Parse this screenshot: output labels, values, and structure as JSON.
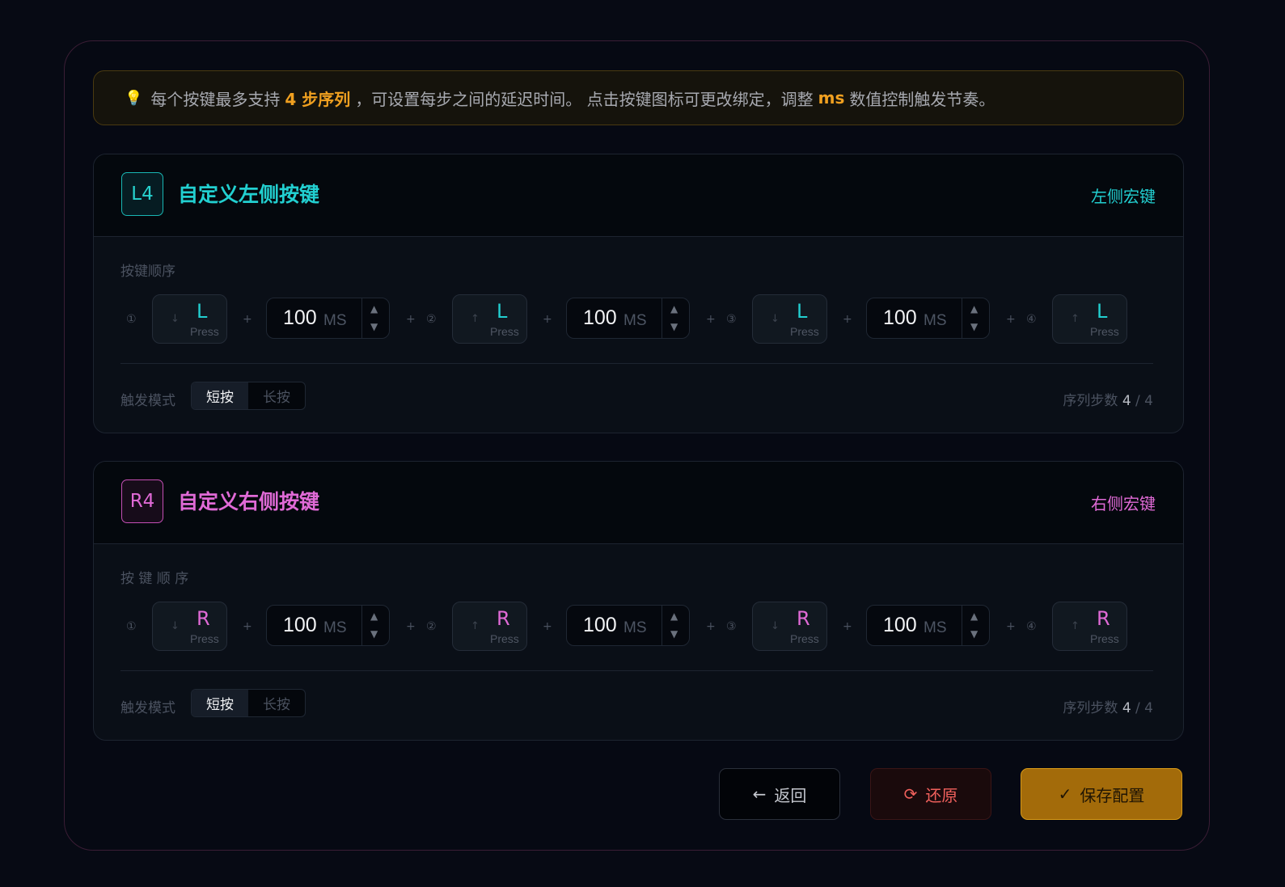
{
  "tip": {
    "icon": "lightbulb-icon",
    "text_1": "每个按键最多支持",
    "highlight_1": "4 步序列",
    "text_2": "，可设置每步之间的延迟时间。 点击按键图标可更改绑定，调整",
    "highlight_2": "ms",
    "text_3": "数值控制触发节奏。"
  },
  "panels": [
    {
      "badge": "L4",
      "title": "自定义左侧按键",
      "tag": "左侧宏键",
      "sequence_label": "按键顺序",
      "steps": [
        {
          "num": "①",
          "arrow": "↓",
          "key": "L",
          "action": "Press"
        },
        {
          "num": "②",
          "arrow": "↑",
          "key": "L",
          "action": "Press"
        },
        {
          "num": "③",
          "arrow": "↓",
          "key": "L",
          "action": "Press"
        },
        {
          "num": "④",
          "arrow": "↑",
          "key": "L",
          "action": "Press"
        }
      ],
      "delays": [
        {
          "value": "100",
          "unit": "MS"
        },
        {
          "value": "100",
          "unit": "MS"
        },
        {
          "value": "100",
          "unit": "MS"
        }
      ],
      "mode_label": "触发模式",
      "mode_short": "短按",
      "mode_long": "长按",
      "steps_label": "序列步数",
      "steps_current": "4",
      "steps_total": "/ 4"
    },
    {
      "badge": "R4",
      "title": "自定义右侧按键",
      "tag": "右侧宏键",
      "sequence_label": "按 键 顺 序",
      "steps": [
        {
          "num": "①",
          "arrow": "↓",
          "key": "R",
          "action": "Press"
        },
        {
          "num": "②",
          "arrow": "↑",
          "key": "R",
          "action": "Press"
        },
        {
          "num": "③",
          "arrow": "↓",
          "key": "R",
          "action": "Press"
        },
        {
          "num": "④",
          "arrow": "↑",
          "key": "R",
          "action": "Press"
        }
      ],
      "delays": [
        {
          "value": "100",
          "unit": "MS"
        },
        {
          "value": "100",
          "unit": "MS"
        },
        {
          "value": "100",
          "unit": "MS"
        }
      ],
      "mode_label": "触发模式",
      "mode_short": "短按",
      "mode_long": "长按",
      "steps_label": "序列步数",
      "steps_current": "4",
      "steps_total": "/ 4"
    }
  ],
  "spinner": {
    "up": "▲",
    "down": "▼"
  },
  "plus": "+",
  "actions": {
    "back": {
      "label": "返回",
      "icon": "arrow-left-icon"
    },
    "reset": {
      "label": "还原",
      "icon": "refresh-icon"
    },
    "save": {
      "label": "保存配置",
      "icon": "check-icon"
    }
  },
  "colors": {
    "left_accent": "#22cfd0",
    "right_accent": "#e06ad6",
    "tip_highlight": "#f0a020",
    "save_button": "#a36b0a",
    "reset_text": "#f0605c"
  }
}
